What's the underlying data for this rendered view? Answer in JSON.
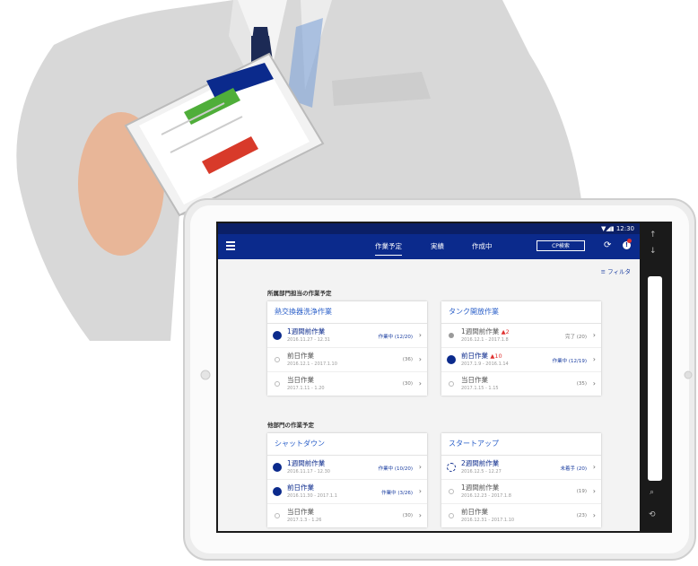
{
  "status_bar": {
    "time": "12:30",
    "signal": "▼◢▮"
  },
  "header": {
    "tabs": [
      {
        "label": "作業予定",
        "active": true
      },
      {
        "label": "実績",
        "active": false
      },
      {
        "label": "作成中",
        "active": false
      }
    ],
    "cp_button": "CP検索",
    "alert_count": "!"
  },
  "filter_label": "フィルタ",
  "sections": [
    {
      "title": "所属部門担当の作業予定",
      "cards": [
        {
          "title": "熱交換器洗浄作業",
          "rows": [
            {
              "name": "1週間前作業",
              "warn": "",
              "date": "2016.11.27 - 12.31",
              "status": "作業中 (12/20)",
              "dot": "full"
            },
            {
              "name": "前日作業",
              "warn": "",
              "date": "2016.12.1 - 2017.1.10",
              "status": "(36)",
              "dot": "hollow"
            },
            {
              "name": "当日作業",
              "warn": "",
              "date": "2017.1.11 - 1.20",
              "status": "(30)",
              "dot": "hollow"
            }
          ]
        },
        {
          "title": "タンク開放作業",
          "rows": [
            {
              "name": "1週間前作業",
              "warn": "▲2",
              "date": "2016.12.1 - 2017.1.8",
              "status": "完了 (20)",
              "dot": "grey"
            },
            {
              "name": "前日作業",
              "warn": "▲10",
              "date": "2017.1.9 - 2016.1.14",
              "status": "作業中 (12/19)",
              "dot": "full"
            },
            {
              "name": "当日作業",
              "warn": "",
              "date": "2017.1.15 - 1.15",
              "status": "(35)",
              "dot": "hollow"
            }
          ]
        }
      ]
    },
    {
      "title": "他部門の作業予定",
      "cards": [
        {
          "title": "シャットダウン",
          "rows": [
            {
              "name": "1週間前作業",
              "warn": "",
              "date": "2016.11.17 - 12.30",
              "status": "作業中 (10/20)",
              "dot": "full"
            },
            {
              "name": "前日作業",
              "warn": "",
              "date": "2016.11.30 - 2017.1.1",
              "status": "作業中 (3/26)",
              "dot": "full"
            },
            {
              "name": "当日作業",
              "warn": "",
              "date": "2017.1.3 - 1.26",
              "status": "(30)",
              "dot": "hollow"
            }
          ]
        },
        {
          "title": "スタートアップ",
          "rows": [
            {
              "name": "2週間前作業",
              "warn": "",
              "date": "2016.12.5 - 12.27",
              "status": "未着手 (20)",
              "dot": "dashed"
            },
            {
              "name": "1週間前作業",
              "warn": "",
              "date": "2016.12.23 - 2017.1.8",
              "status": "(19)",
              "dot": "hollow"
            },
            {
              "name": "前日作業",
              "warn": "",
              "date": "2016.12.31 - 2017.1.10",
              "status": "(23)",
              "dot": "hollow"
            }
          ]
        }
      ]
    }
  ],
  "colors": {
    "primary": "#0b2a8c",
    "accent": "#2a5fc9",
    "warning": "#e0312f",
    "background": "#f3f3f3"
  }
}
